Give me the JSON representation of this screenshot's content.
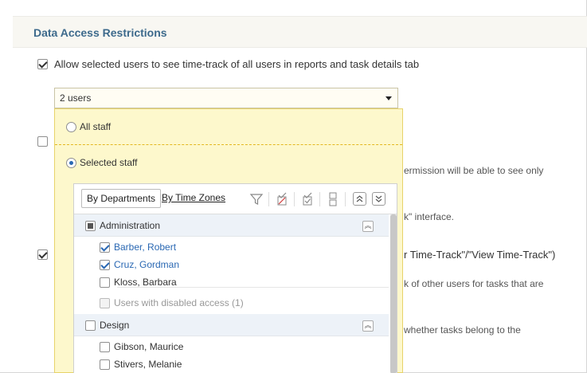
{
  "section": {
    "title": "Data Access Restrictions"
  },
  "allow_option": {
    "label": "Allow selected users to see time-track of all users in reports and task details tab",
    "checked": true
  },
  "users_select": {
    "value": "2 users"
  },
  "dropdown": {
    "all_staff_label": "All staff",
    "selected_staff_label": "Selected staff",
    "selected_option": "Selected staff",
    "toolbar": {
      "tab_departments": "By Departments",
      "tab_timezones": "By Time Zones"
    },
    "groups": [
      {
        "name": "Administration",
        "state": "partial",
        "members": [
          {
            "name": "Barber, Robert",
            "checked": true
          },
          {
            "name": "Cruz, Gordman",
            "checked": true
          },
          {
            "name": "Kloss, Barbara",
            "checked": false
          }
        ],
        "disabled_label": "Users with disabled access (1)"
      },
      {
        "name": "Design",
        "state": "unchecked",
        "members": [
          {
            "name": "Gibson, Maurice",
            "checked": false
          },
          {
            "name": "Stivers, Melanie",
            "checked": false
          }
        ]
      }
    ]
  },
  "background": {
    "text1": "ermission will be able to see only",
    "text2": "k\" interface.",
    "text3": "r Time-Track\"/\"View Time-Track\")",
    "text4": "k of other users for tasks that are",
    "text5": "whether tasks belong to the"
  }
}
